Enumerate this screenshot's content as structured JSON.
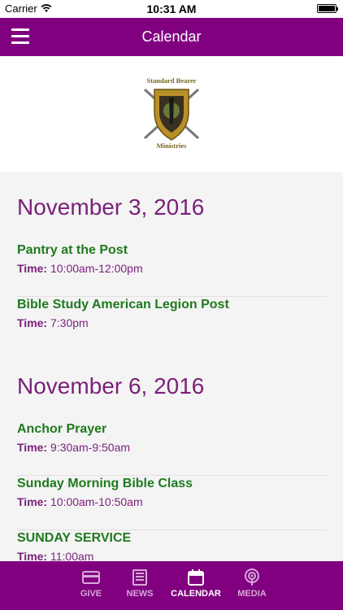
{
  "status_bar": {
    "carrier": "Carrier",
    "time": "10:31 AM"
  },
  "header": {
    "title": "Calendar"
  },
  "logo": {
    "line1": "Standard Bearer",
    "line2": "Ministries"
  },
  "days": [
    {
      "date": "November 3, 2016",
      "events": [
        {
          "name": "Pantry at the Post",
          "time_label": "Time:",
          "time": "10:00am-12:00pm"
        },
        {
          "name": "Bible Study American Legion Post",
          "time_label": "Time:",
          "time": "7:30pm"
        }
      ]
    },
    {
      "date": "November 6, 2016",
      "events": [
        {
          "name": "Anchor Prayer",
          "time_label": "Time:",
          "time": "9:30am-9:50am"
        },
        {
          "name": "Sunday Morning Bible Class",
          "time_label": "Time:",
          "time": "10:00am-10:50am"
        },
        {
          "name": "SUNDAY SERVICE",
          "time_label": "Time:",
          "time": "11:00am"
        }
      ]
    }
  ],
  "tabs": [
    {
      "label": "GIVE",
      "icon": "card-icon",
      "active": false
    },
    {
      "label": "NEWS",
      "icon": "news-icon",
      "active": false
    },
    {
      "label": "CALENDAR",
      "icon": "calendar-icon",
      "active": true
    },
    {
      "label": "MEDIA",
      "icon": "podcast-icon",
      "active": false
    }
  ],
  "colors": {
    "brand": "#800080",
    "date_heading": "#7a1f7a",
    "event_name": "#1e7a1e"
  }
}
